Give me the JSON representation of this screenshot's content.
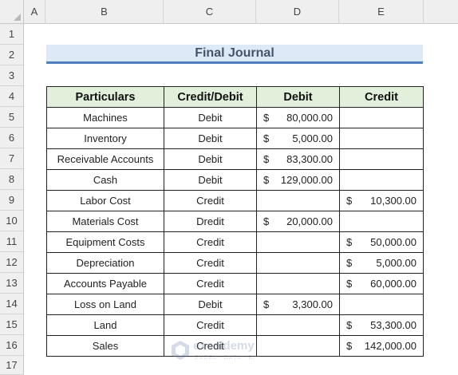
{
  "columns": [
    "A",
    "B",
    "C",
    "D",
    "E"
  ],
  "rows": [
    "1",
    "2",
    "3",
    "4",
    "5",
    "6",
    "7",
    "8",
    "9",
    "10",
    "11",
    "12",
    "13",
    "14",
    "15",
    "16",
    "17"
  ],
  "title": "Final Journal",
  "headers": {
    "particulars": "Particulars",
    "credit_debit": "Credit/Debit",
    "debit": "Debit",
    "credit": "Credit"
  },
  "currency_symbol": "$",
  "entries": [
    {
      "particulars": "Machines",
      "type": "Debit",
      "debit": "80,000.00",
      "credit": ""
    },
    {
      "particulars": "Inventory",
      "type": "Debit",
      "debit": "5,000.00",
      "credit": ""
    },
    {
      "particulars": "Receivable Accounts",
      "type": "Debit",
      "debit": "83,300.00",
      "credit": ""
    },
    {
      "particulars": "Cash",
      "type": "Debit",
      "debit": "129,000.00",
      "credit": ""
    },
    {
      "particulars": "Labor Cost",
      "type": "Credit",
      "debit": "",
      "credit": "10,300.00"
    },
    {
      "particulars": "Materials Cost",
      "type": "Dredit",
      "debit": "20,000.00",
      "credit": ""
    },
    {
      "particulars": "Equipment Costs",
      "type": "Credit",
      "debit": "",
      "credit": "50,000.00"
    },
    {
      "particulars": "Depreciation",
      "type": "Credit",
      "debit": "",
      "credit": "5,000.00"
    },
    {
      "particulars": "Accounts Payable",
      "type": "Credit",
      "debit": "",
      "credit": "60,000.00"
    },
    {
      "particulars": "Loss on Land",
      "type": "Debit",
      "debit": "3,300.00",
      "credit": ""
    },
    {
      "particulars": "Land",
      "type": "Credit",
      "debit": "",
      "credit": "53,300.00"
    },
    {
      "particulars": "Sales",
      "type": "Credit",
      "debit": "",
      "credit": "142,000.00"
    }
  ],
  "watermark": {
    "name": "exceldemy",
    "tagline": "EXCEL · DATA · BI"
  },
  "colors": {
    "header_fill": "#e2efda",
    "title_fill": "#dde9f6",
    "title_border": "#4f7fbf",
    "title_text": "#44546a"
  }
}
